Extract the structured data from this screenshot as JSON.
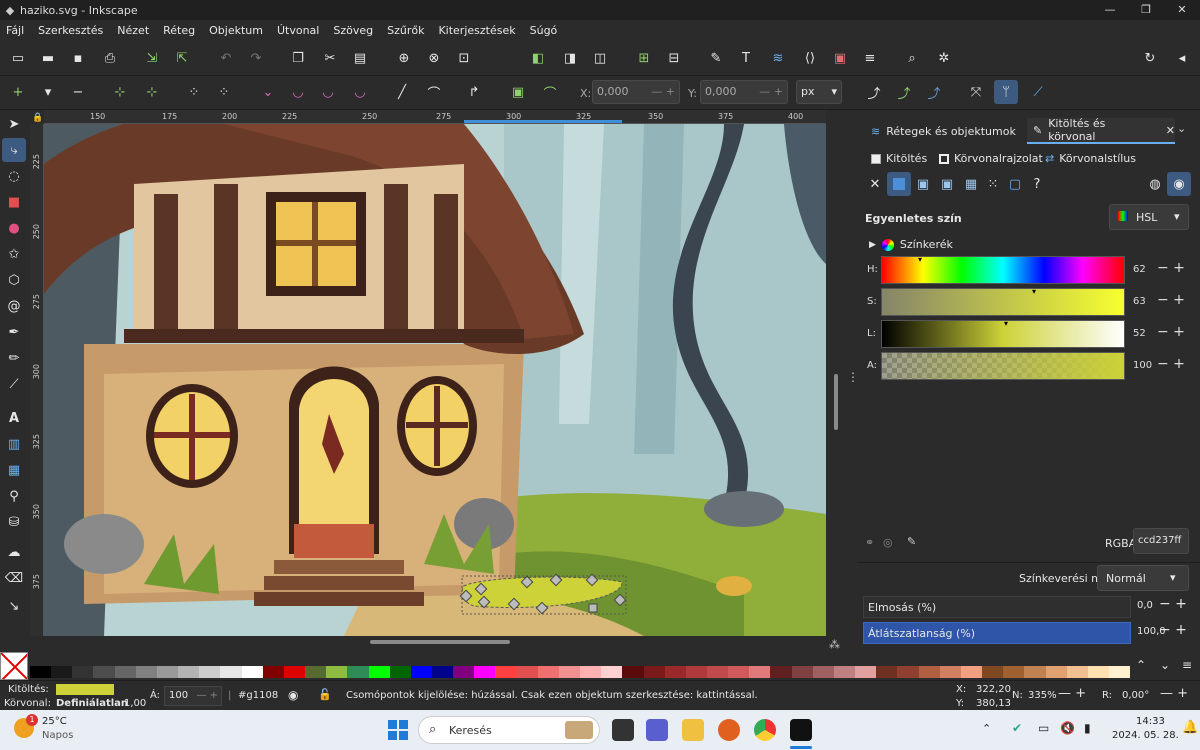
{
  "window": {
    "title": "haziko.svg - Inkscape",
    "minimize": "—",
    "maximize": "❐",
    "close": "✕"
  },
  "menu": [
    "Fájl",
    "Szerkesztés",
    "Nézet",
    "Réteg",
    "Objektum",
    "Útvonal",
    "Szöveg",
    "Szűrők",
    "Kiterjesztések",
    "Súgó"
  ],
  "tool_controls": {
    "x_label": "X:",
    "x_value": "0,000",
    "y_label": "Y:",
    "y_value": "0,000",
    "unit": "px"
  },
  "ruler": {
    "top": [
      "150",
      "175",
      "200",
      "225",
      "250",
      "275",
      "300",
      "325",
      "350",
      "375",
      "400"
    ],
    "left": [
      "225",
      "250",
      "275",
      "300",
      "325",
      "350",
      "375"
    ]
  },
  "panel": {
    "tabs": [
      {
        "label": "Rétegek és objektumok"
      },
      {
        "label": "Kitöltés és körvonal"
      }
    ],
    "subtabs": [
      {
        "label": "Kitöltés"
      },
      {
        "label": "Körvonalrajzolat"
      },
      {
        "label": "Körvonalstílus"
      }
    ],
    "flat_color": "Egyenletes szín",
    "mode": "HSL",
    "wheel": "Színkerék",
    "channels": [
      {
        "label": "H:",
        "value": "62"
      },
      {
        "label": "S:",
        "value": "63"
      },
      {
        "label": "L:",
        "value": "52"
      },
      {
        "label": "A:",
        "value": "100"
      }
    ],
    "rgba_label": "RGBA:",
    "rgba_value": "ccd237ff",
    "blend_label": "Színkeverési mód:",
    "blend_value": "Normál",
    "blur_label": "Elmosás (%)",
    "blur_value": "0,0",
    "opacity_label": "Átlátszatlanság (%)",
    "opacity_value": "100,0"
  },
  "status": {
    "fill_label": "Kitöltés:",
    "stroke_label": "Körvonal:",
    "stroke_value": "Definiálatlan",
    "stroke_width": "1,00",
    "opacity_label": "Á:",
    "opacity_value": "100",
    "layer": "#g1108",
    "message": "Csomópontok kijelölése: húzással. Csak ezen objektum szerkesztése: kattintással.",
    "x_label": "X:",
    "x": "322,20",
    "y_label": "Y:",
    "y": "380,13",
    "zoom_label": "N:",
    "zoom": "335%",
    "rot_label": "R:",
    "rotation": "0,00°"
  },
  "taskbar": {
    "temp": "25°C",
    "weather": "Napos",
    "badge": "1",
    "search": "Keresés",
    "time": "14:33",
    "date": "2024. 05. 28."
  },
  "colors": {
    "fill": "#ccd237",
    "accent": "#2f55a8"
  }
}
